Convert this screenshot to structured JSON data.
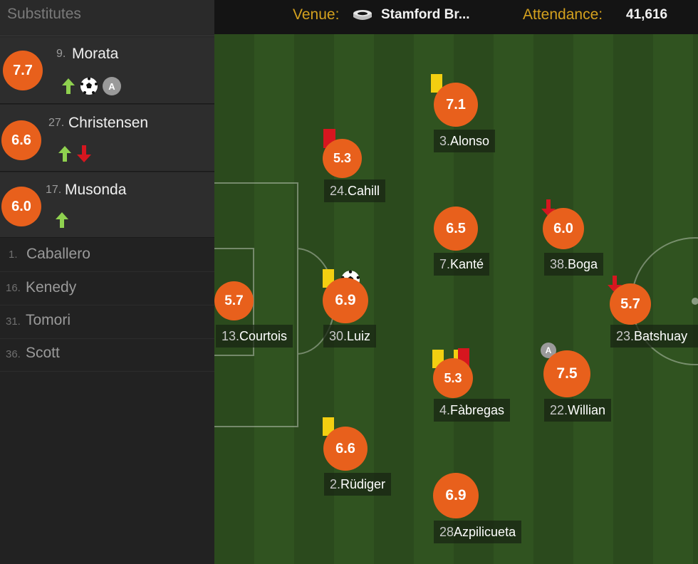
{
  "substitutes_panel": {
    "title": "Substitutes",
    "used": [
      {
        "rating": "7.7",
        "number": "9.",
        "name": "Morata",
        "icons": [
          "sub-on-arrow",
          "ball-icon",
          "assist-icon"
        ],
        "assist_letter": "A"
      },
      {
        "rating": "6.6",
        "number": "27.",
        "name": "Christensen",
        "icons": [
          "sub-on-arrow",
          "sub-off-arrow"
        ]
      },
      {
        "rating": "6.0",
        "number": "17.",
        "name": "Musonda",
        "icons": [
          "sub-on-arrow"
        ]
      }
    ],
    "unused": [
      {
        "number": "1.",
        "name": "Caballero"
      },
      {
        "number": "16.",
        "name": "Kenedy"
      },
      {
        "number": "31.",
        "name": "Tomori"
      },
      {
        "number": "36.",
        "name": "Scott"
      }
    ]
  },
  "match_info": {
    "venue_label": "Venue:",
    "venue_value": "Stamford Br...",
    "venue_icon": "stadium-icon",
    "attendance_label": "Attendance:",
    "attendance_value": "41,616"
  },
  "pitch": {
    "players": [
      {
        "id": "courtois",
        "rating": "5.7",
        "number": "13.",
        "name": "Courtois"
      },
      {
        "id": "cahill",
        "rating": "5.3",
        "number": "24.",
        "name": "Cahill",
        "cards": [
          "red"
        ]
      },
      {
        "id": "luiz",
        "rating": "6.9",
        "number": "30.",
        "name": "Luiz",
        "cards": [
          "yellow"
        ],
        "goal": true
      },
      {
        "id": "rudiger",
        "rating": "6.6",
        "number": "2.",
        "name": "Rüdiger",
        "cards": [
          "yellow"
        ]
      },
      {
        "id": "alonso",
        "rating": "7.1",
        "number": "3.",
        "name": "Alonso",
        "cards": [
          "yellow"
        ]
      },
      {
        "id": "kante",
        "rating": "6.5",
        "number": "7.",
        "name": "Kanté"
      },
      {
        "id": "fabregas",
        "rating": "5.3",
        "number": "4.",
        "name": "Fàbregas",
        "cards": [
          "yellow",
          "second-yellow-red"
        ]
      },
      {
        "id": "azpilicueta",
        "rating": "6.9",
        "number": "28",
        "name": "Azpilicueta"
      },
      {
        "id": "boga",
        "rating": "6.0",
        "number": "38.",
        "name": "Boga",
        "subbed_off": true
      },
      {
        "id": "willian",
        "rating": "7.5",
        "number": "22.",
        "name": "Willian",
        "assist": true,
        "assist_letter": "A"
      },
      {
        "id": "batshuayi",
        "rating": "5.7",
        "number": "23.",
        "name": "Batshuay",
        "subbed_off": true
      }
    ]
  },
  "colors": {
    "rating_orange": "#e8601c",
    "yellow_card": "#f3cf11",
    "red_card": "#d6161f",
    "sub_on_green": "#8fd14f",
    "sub_off_red": "#d6161f",
    "label_gold": "#d4a11e"
  }
}
